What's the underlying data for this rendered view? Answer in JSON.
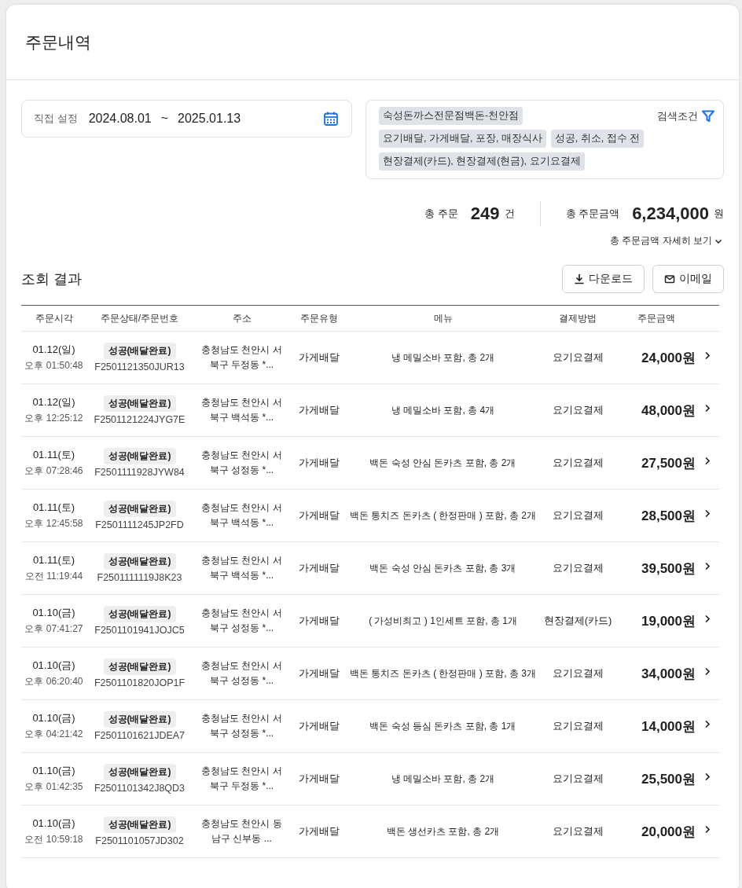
{
  "page": {
    "title": "주문내역"
  },
  "period": {
    "label": "직접 설정",
    "start": "2024.08.01",
    "separator": "~",
    "end": "2025.01.13"
  },
  "filters": {
    "label": "검색조건",
    "tag_rows": [
      [
        "숙성돈까스전문점백돈-천안점"
      ],
      [
        "요기배달, 가게배달, 포장, 매장식사",
        "성공, 취소, 접수 전"
      ],
      [
        "현장결제(카드), 현장결제(현금), 요기요결제"
      ]
    ]
  },
  "summary": [
    {
      "label": "총 주문",
      "value": "249",
      "unit": "건"
    },
    {
      "label": "총 주문금액",
      "value": "6,234,000",
      "unit": "원"
    }
  ],
  "detail_link": "총 주문금액 자세히 보기",
  "results": {
    "title": "조회 결과",
    "buttons": [
      {
        "kind": "download",
        "label": "다운로드"
      },
      {
        "kind": "email",
        "label": "이메일"
      }
    ]
  },
  "table": {
    "columns": [
      "주문시각",
      "주문상태/주문번호",
      "주소",
      "주문유형",
      "메뉴",
      "결제방법",
      "주문금액"
    ],
    "rows": [
      {
        "date": "01.12(일)",
        "time": "오후 01:50:48",
        "status": "성공(배달완료)",
        "order_no": "F2501121350JUR13",
        "address": "충청남도 천안시 서\n북구 두정동 *...",
        "type": "가게배달",
        "menu": "냉 메밀소바 포함, 총 2개",
        "payment": "요기요결제",
        "amount": "24,000원"
      },
      {
        "date": "01.12(일)",
        "time": "오후 12:25:12",
        "status": "성공(배달완료)",
        "order_no": "F2501121224JYG7E",
        "address": "충청남도 천안시 서\n북구 백석동 *...",
        "type": "가게배달",
        "menu": "냉 메밀소바 포함, 총 4개",
        "payment": "요기요결제",
        "amount": "48,000원"
      },
      {
        "date": "01.11(토)",
        "time": "오후 07:28:46",
        "status": "성공(배달완료)",
        "order_no": "F2501111928JYW84",
        "address": "충청남도 천안시 서\n북구 성정동 *...",
        "type": "가게배달",
        "menu": "백돈 숙성 안심 돈카츠 포함, 총 2개",
        "payment": "요기요결제",
        "amount": "27,500원"
      },
      {
        "date": "01.11(토)",
        "time": "오후 12:45:58",
        "status": "성공(배달완료)",
        "order_no": "F2501111245JP2FD",
        "address": "충청남도 천안시 서\n북구 백석동 *...",
        "type": "가게배달",
        "menu": "백돈 통치즈 돈카츠 ( 한정판매 )  포함, 총 2개",
        "payment": "요기요결제",
        "amount": "28,500원"
      },
      {
        "date": "01.11(토)",
        "time": "오전 11:19:44",
        "status": "성공(배달완료)",
        "order_no": "F2501111119J8K23",
        "address": "충청남도 천안시 서\n북구 백석동 *...",
        "type": "가게배달",
        "menu": "백돈 숙성 안심 돈카츠 포함, 총 3개",
        "payment": "요기요결제",
        "amount": "39,500원"
      },
      {
        "date": "01.10(금)",
        "time": "오후 07:41:27",
        "status": "성공(배달완료)",
        "order_no": "F2501101941JOJC5",
        "address": "충청남도 천안시 서\n북구 성정동 *...",
        "type": "가게배달",
        "menu": "( 가성비최고 ) 1인세트 포함, 총 1개",
        "payment": "현장결제(카드)",
        "amount": "19,000원"
      },
      {
        "date": "01.10(금)",
        "time": "오후 06:20:40",
        "status": "성공(배달완료)",
        "order_no": "F2501101820JOP1F",
        "address": "충청남도 천안시 서\n북구 성정동 *...",
        "type": "가게배달",
        "menu": "백돈 통치즈 돈카츠 ( 한정판매 )  포함, 총 3개",
        "payment": "요기요결제",
        "amount": "34,000원"
      },
      {
        "date": "01.10(금)",
        "time": "오후 04:21:42",
        "status": "성공(배달완료)",
        "order_no": "F2501101621JDEA7",
        "address": "충청남도 천안시 서\n북구 성정동 *...",
        "type": "가게배달",
        "menu": "백돈 숙성 등심 돈카츠 포함, 총 1개",
        "payment": "요기요결제",
        "amount": "14,000원"
      },
      {
        "date": "01.10(금)",
        "time": "오후 01:42:35",
        "status": "성공(배달완료)",
        "order_no": "F2501101342J8QD3",
        "address": "충청남도 천안시 서\n북구 두정동 *...",
        "type": "가게배달",
        "menu": "냉 메밀소바 포함, 총 2개",
        "payment": "요기요결제",
        "amount": "25,500원"
      },
      {
        "date": "01.10(금)",
        "time": "오전 10:59:18",
        "status": "성공(배달완료)",
        "order_no": "F2501101057JD302",
        "address": "충청남도 천안시 동\n남구 신부동 ...",
        "type": "가게배달",
        "menu": "백돈 생선카츠 포함, 총 2개",
        "payment": "요기요결제",
        "amount": "20,000원"
      }
    ]
  }
}
